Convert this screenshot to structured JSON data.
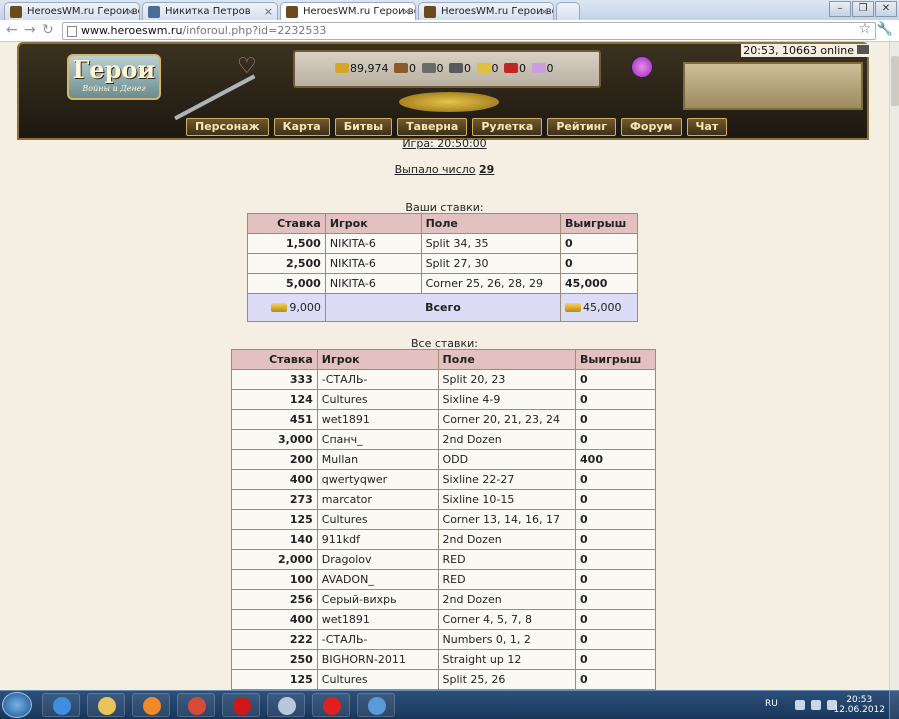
{
  "browser": {
    "tabs": [
      {
        "title": "HeroesWM.ru Герои войны",
        "icon": "heroes-icon"
      },
      {
        "title": "Никитка Петров",
        "icon": "vk-icon"
      },
      {
        "title": "HeroesWM.ru Герои войны",
        "icon": "heroes-icon"
      },
      {
        "title": "HeroesWM.ru Герои войны",
        "icon": "heroes-icon"
      }
    ],
    "url_host": "www.heroeswm.ru",
    "url_path": "/inforoul.php?id=2232533"
  },
  "header": {
    "logo_title": "Герои",
    "logo_subtitle": "Войны и Денег",
    "clock": "20:53, 10663 online",
    "resources": [
      "89,974",
      "0",
      "0",
      "0",
      "0",
      "0",
      "0"
    ],
    "resource_colors": [
      "#d4a62a",
      "#8a5a2c",
      "#6b6b6b",
      "#5a5a5a",
      "#e0c040",
      "#c02626",
      "#c8a0e0"
    ]
  },
  "nav": [
    "Персонаж",
    "Карта",
    "Битвы",
    "Таверна",
    "Рулетка",
    "Рейтинг",
    "Форум",
    "Чат"
  ],
  "game": {
    "time_label": "Игра: 20:50:00",
    "result_prefix": "Выпало число",
    "result_number": "29"
  },
  "your_bets": {
    "title": "Ваши ставки:",
    "headers": [
      "Ставка",
      "Игрок",
      "Поле",
      "Выигрыш"
    ],
    "rows": [
      [
        "1,500",
        "NIKITA-6",
        "Split 34, 35",
        "0"
      ],
      [
        "2,500",
        "NIKITA-6",
        "Split 27, 30",
        "0"
      ],
      [
        "5,000",
        "NIKITA-6",
        "Corner 25, 26, 28, 29",
        "45,000"
      ]
    ],
    "total_bet": "9,000",
    "total_label": "Всего",
    "total_win": "45,000"
  },
  "all_bets": {
    "title": "Все ставки:",
    "headers": [
      "Ставка",
      "Игрок",
      "Поле",
      "Выигрыш"
    ],
    "rows": [
      [
        "333",
        "-СТАЛЬ-",
        "Split 20, 23",
        "0"
      ],
      [
        "124",
        "Cultures",
        "Sixline 4-9",
        "0"
      ],
      [
        "451",
        "wet1891",
        "Corner 20, 21, 23, 24",
        "0"
      ],
      [
        "3,000",
        "Спанч_",
        "2nd Dozen",
        "0"
      ],
      [
        "200",
        "Mullan",
        "ODD",
        "400"
      ],
      [
        "400",
        "qwertyqwer",
        "Sixline 22-27",
        "0"
      ],
      [
        "273",
        "marcator",
        "Sixline 10-15",
        "0"
      ],
      [
        "125",
        "Cultures",
        "Corner 13, 14, 16, 17",
        "0"
      ],
      [
        "140",
        "911kdf",
        "2nd Dozen",
        "0"
      ],
      [
        "2,000",
        "Dragolov",
        "RED",
        "0"
      ],
      [
        "100",
        "AVADON_",
        "RED",
        "0"
      ],
      [
        "256",
        "Серый-вихрь",
        "2nd Dozen",
        "0"
      ],
      [
        "400",
        "wet1891",
        "Corner 4, 5, 7, 8",
        "0"
      ],
      [
        "222",
        "-СТАЛЬ-",
        "Numbers 0, 1, 2",
        "0"
      ],
      [
        "250",
        "BIGHORN-2011",
        "Straight up 12",
        "0"
      ],
      [
        "125",
        "Cultures",
        "Split 25, 26",
        "0"
      ]
    ]
  },
  "taskbar": {
    "lang": "RU",
    "time": "20:53",
    "date": "12.06.2012",
    "apps": [
      {
        "name": "ie",
        "color": "#3d8fe0"
      },
      {
        "name": "explorer",
        "color": "#e8c45a"
      },
      {
        "name": "media",
        "color": "#f08a2a"
      },
      {
        "name": "chrome",
        "color": "#d84a3a"
      },
      {
        "name": "opera",
        "color": "#d01818"
      },
      {
        "name": "notepad",
        "color": "#b8c8dc"
      },
      {
        "name": "yandex",
        "color": "#e02020"
      },
      {
        "name": "mail",
        "color": "#5a9ad8"
      }
    ]
  }
}
